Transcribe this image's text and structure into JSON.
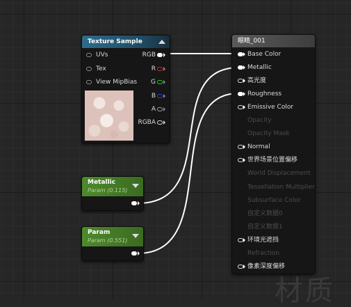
{
  "texture_sample": {
    "title": "Texture Sample",
    "inputs": [
      "UVs",
      "Tex",
      "View MipBias"
    ],
    "outputs": [
      {
        "label": "RGB",
        "color": "#ffffff"
      },
      {
        "label": "R",
        "color": "#e02020"
      },
      {
        "label": "G",
        "color": "#20d020"
      },
      {
        "label": "B",
        "color": "#2040f0"
      },
      {
        "label": "A",
        "color": "#9a9a9a"
      },
      {
        "label": "RGBA",
        "color": "#dcdcdc"
      }
    ]
  },
  "material": {
    "title": "眼睛_001",
    "pins": [
      {
        "label": "Base Color",
        "enabled": true,
        "connected": true
      },
      {
        "label": "Metallic",
        "enabled": true,
        "connected": true
      },
      {
        "label": "高光度",
        "enabled": true,
        "connected": false
      },
      {
        "label": "Roughness",
        "enabled": true,
        "connected": true
      },
      {
        "label": "Emissive Color",
        "enabled": true,
        "connected": false
      },
      {
        "label": "Opacity",
        "enabled": false,
        "connected": false
      },
      {
        "label": "Opacity Mask",
        "enabled": false,
        "connected": false
      },
      {
        "label": "Normal",
        "enabled": true,
        "connected": false
      },
      {
        "label": "世界场景位置偏移",
        "enabled": true,
        "connected": false
      },
      {
        "label": "World Displacement",
        "enabled": false,
        "connected": false
      },
      {
        "label": "Tessellation Multiplier",
        "enabled": false,
        "connected": false
      },
      {
        "label": "Subsurface Color",
        "enabled": false,
        "connected": false
      },
      {
        "label": "自定义数据0",
        "enabled": false,
        "connected": false
      },
      {
        "label": "自定义数据1",
        "enabled": false,
        "connected": false
      },
      {
        "label": "环境光遮挡",
        "enabled": true,
        "connected": false
      },
      {
        "label": "Refraction",
        "enabled": false,
        "connected": false
      },
      {
        "label": "像素深度偏移",
        "enabled": true,
        "connected": false
      }
    ]
  },
  "metallic_param": {
    "title": "Metallic",
    "subtitle": "Param (0.115)"
  },
  "roughness_param": {
    "title": "Param",
    "subtitle": "Param (0.551)"
  },
  "watermark": "材质",
  "colors": {
    "header_texture": "#2e6c8c",
    "header_param": "#4e8a2c",
    "header_material": "#5a5a5a",
    "wire": "#ffffff"
  }
}
